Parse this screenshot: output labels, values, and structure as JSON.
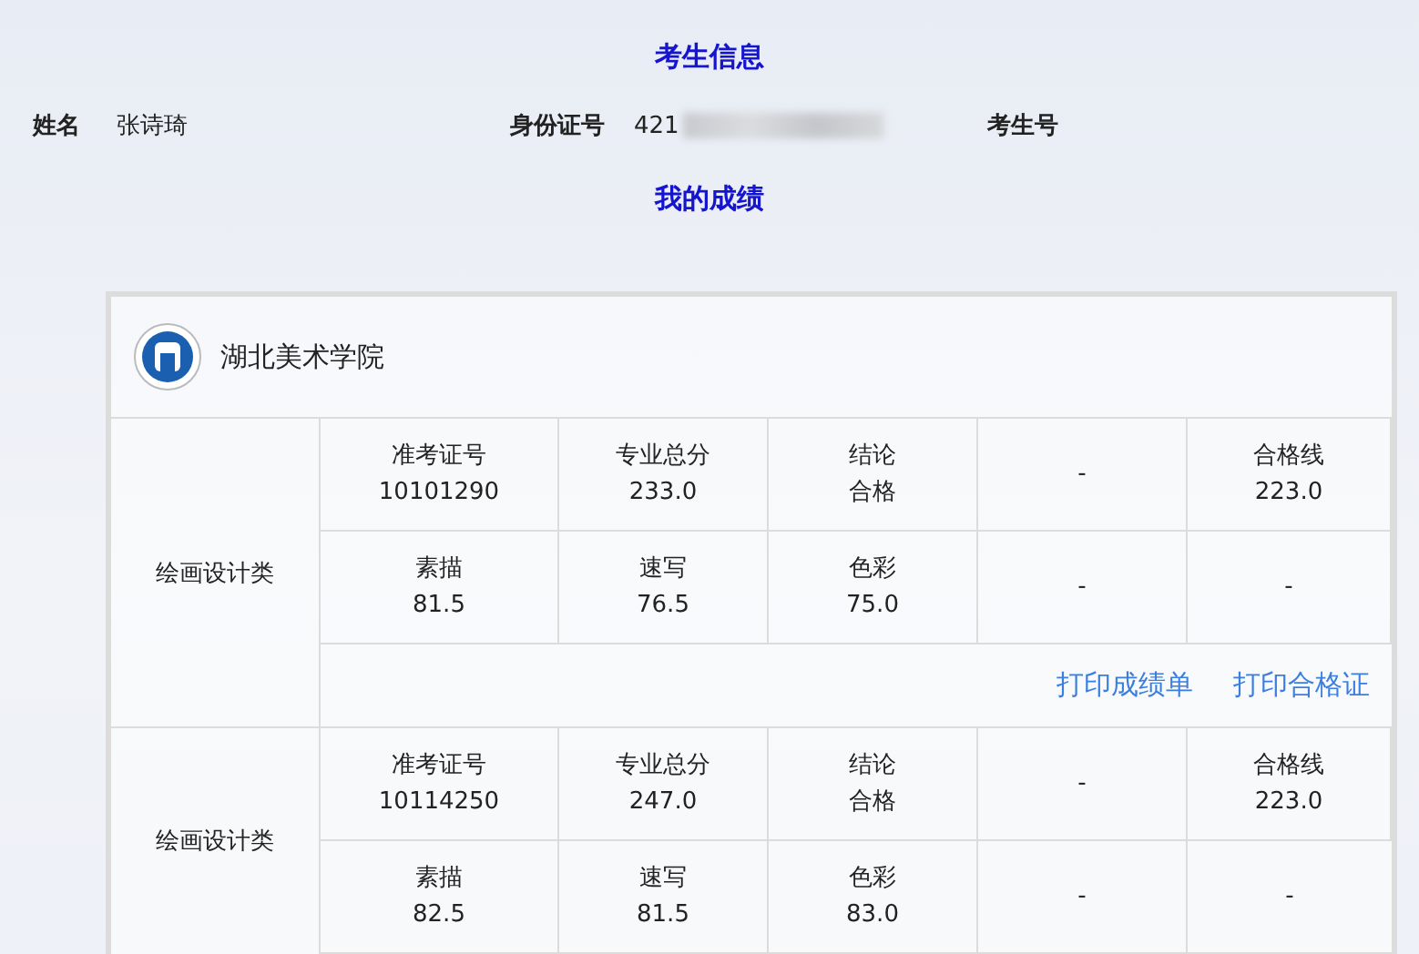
{
  "student_info": {
    "title": "考生信息",
    "fields": [
      {
        "label": "姓名",
        "value": "张诗琦",
        "kind": "text"
      },
      {
        "label": "身份证号",
        "value": "421",
        "kind": "redacted"
      },
      {
        "label": "考生号",
        "kind": "empty"
      }
    ]
  },
  "scores": {
    "title": "我的成绩",
    "school": "湖北美术学院",
    "groups": [
      {
        "category": "绘画设计类",
        "rows": [
          [
            {
              "label": "准考证号",
              "value": "10101290"
            },
            {
              "label": "专业总分",
              "value": "233.0"
            },
            {
              "label": "结论",
              "value": "合格"
            },
            {
              "value": "-"
            },
            {
              "label": "合格线",
              "value": "223.0"
            }
          ],
          [
            {
              "label": "素描",
              "value": "81.5"
            },
            {
              "label": "速写",
              "value": "76.5"
            },
            {
              "label": "色彩",
              "value": "75.0"
            },
            {
              "value": "-"
            },
            {
              "value": "-"
            }
          ]
        ],
        "actions": [
          "打印成绩单",
          "打印合格证"
        ]
      },
      {
        "category": "绘画设计类",
        "rows": [
          [
            {
              "label": "准考证号",
              "value": "10114250"
            },
            {
              "label": "专业总分",
              "value": "247.0"
            },
            {
              "label": "结论",
              "value": "合格"
            },
            {
              "value": "-"
            },
            {
              "label": "合格线",
              "value": "223.0"
            }
          ],
          [
            {
              "label": "素描",
              "value": "82.5"
            },
            {
              "label": "速写",
              "value": "81.5"
            },
            {
              "label": "色彩",
              "value": "83.0"
            },
            {
              "value": "-"
            },
            {
              "value": "-"
            }
          ]
        ]
      }
    ]
  }
}
